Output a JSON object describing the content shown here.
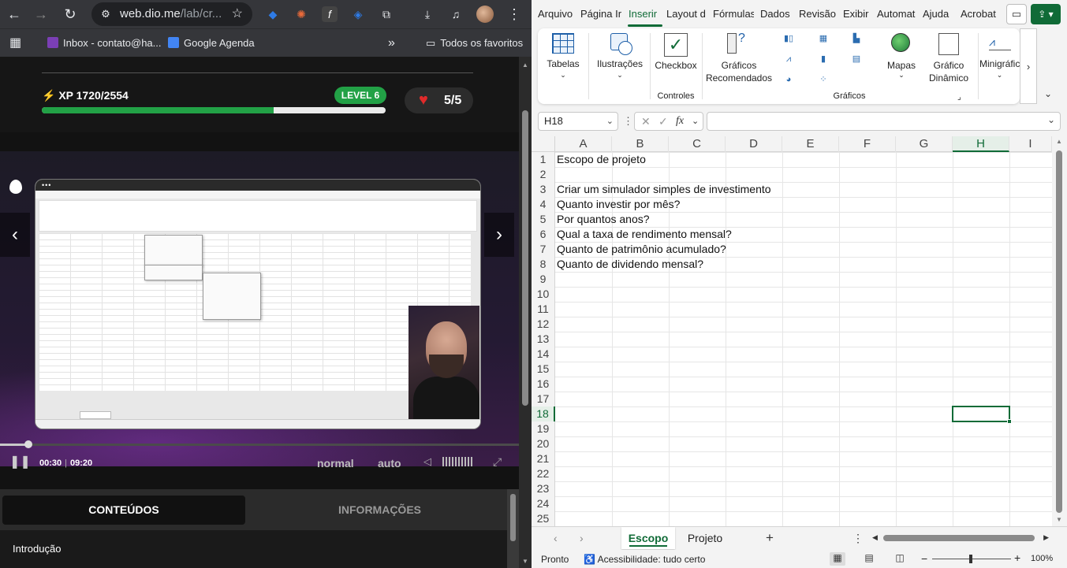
{
  "browser": {
    "url_domain": "web.dio.me",
    "url_path": "/lab/cr...",
    "bookmarks": [
      {
        "label": "Inbox - contato@ha..."
      },
      {
        "label": "Google Agenda"
      }
    ],
    "all_favorites": "Todos os favoritos",
    "more_bookmarks": "»"
  },
  "dio": {
    "xp_label": "XP 1720/2554",
    "xp_progress": 0.674,
    "level": "LEVEL 6",
    "lives": "5/5",
    "video": {
      "current_time": "00:30",
      "separator": "|",
      "duration": "09:20",
      "progress": 0.054,
      "speed": "normal",
      "quality": "auto"
    },
    "tabs": [
      "CONTEÚDOS",
      "INFORMAÇÕES"
    ],
    "active_tab": "CONTEÚDOS",
    "list_first_item": "Introdução"
  },
  "excel": {
    "menu": [
      "Arquivo",
      "Página Ir",
      "Inserir",
      "Layout d",
      "Fórmulas",
      "Dados",
      "Revisão",
      "Exibir",
      "Automat",
      "Ajuda",
      "Acrobat"
    ],
    "active_menu": "Inserir",
    "ribbon": {
      "tables": "Tabelas",
      "illustrations": "Ilustrações",
      "checkbox": "Checkbox",
      "controls_group": "Controles",
      "recommended_charts_1": "Gráficos",
      "recommended_charts_2": "Recomendados",
      "charts_group": "Gráficos",
      "maps": "Mapas",
      "pivot_chart_1": "Gráfico",
      "pivot_chart_2": "Dinâmico",
      "sparklines": "Minigráfic"
    },
    "name_box": "H18",
    "fx_label": "fx",
    "columns": [
      "A",
      "B",
      "C",
      "D",
      "E",
      "F",
      "G",
      "H",
      "I"
    ],
    "selected_column": "H",
    "selected_row": 18,
    "rows": [
      1,
      2,
      3,
      4,
      5,
      6,
      7,
      8,
      9,
      10,
      11,
      12,
      13,
      14,
      15,
      16,
      17,
      18,
      19,
      20,
      21,
      22,
      23,
      24,
      25
    ],
    "cells": [
      {
        "row": 1,
        "text": "Escopo de projeto"
      },
      {
        "row": 3,
        "text": "Criar um simulador simples de investimento"
      },
      {
        "row": 4,
        "text": "Quanto investir por mês?"
      },
      {
        "row": 5,
        "text": "Por quantos anos?"
      },
      {
        "row": 6,
        "text": "Qual a taxa de rendimento mensal?"
      },
      {
        "row": 7,
        "text": "Quanto de patrimônio acumulado?"
      },
      {
        "row": 8,
        "text": "Quanto de dividendo mensal?"
      }
    ],
    "sheets": [
      "Escopo",
      "Projeto"
    ],
    "active_sheet": "Escopo",
    "status_ready": "Pronto",
    "accessibility": "Acessibilidade: tudo certo",
    "zoom": "100%"
  },
  "colors": {
    "excel_green": "#106b37",
    "dio_green": "#22a146",
    "heart_red": "#e02a2a"
  }
}
